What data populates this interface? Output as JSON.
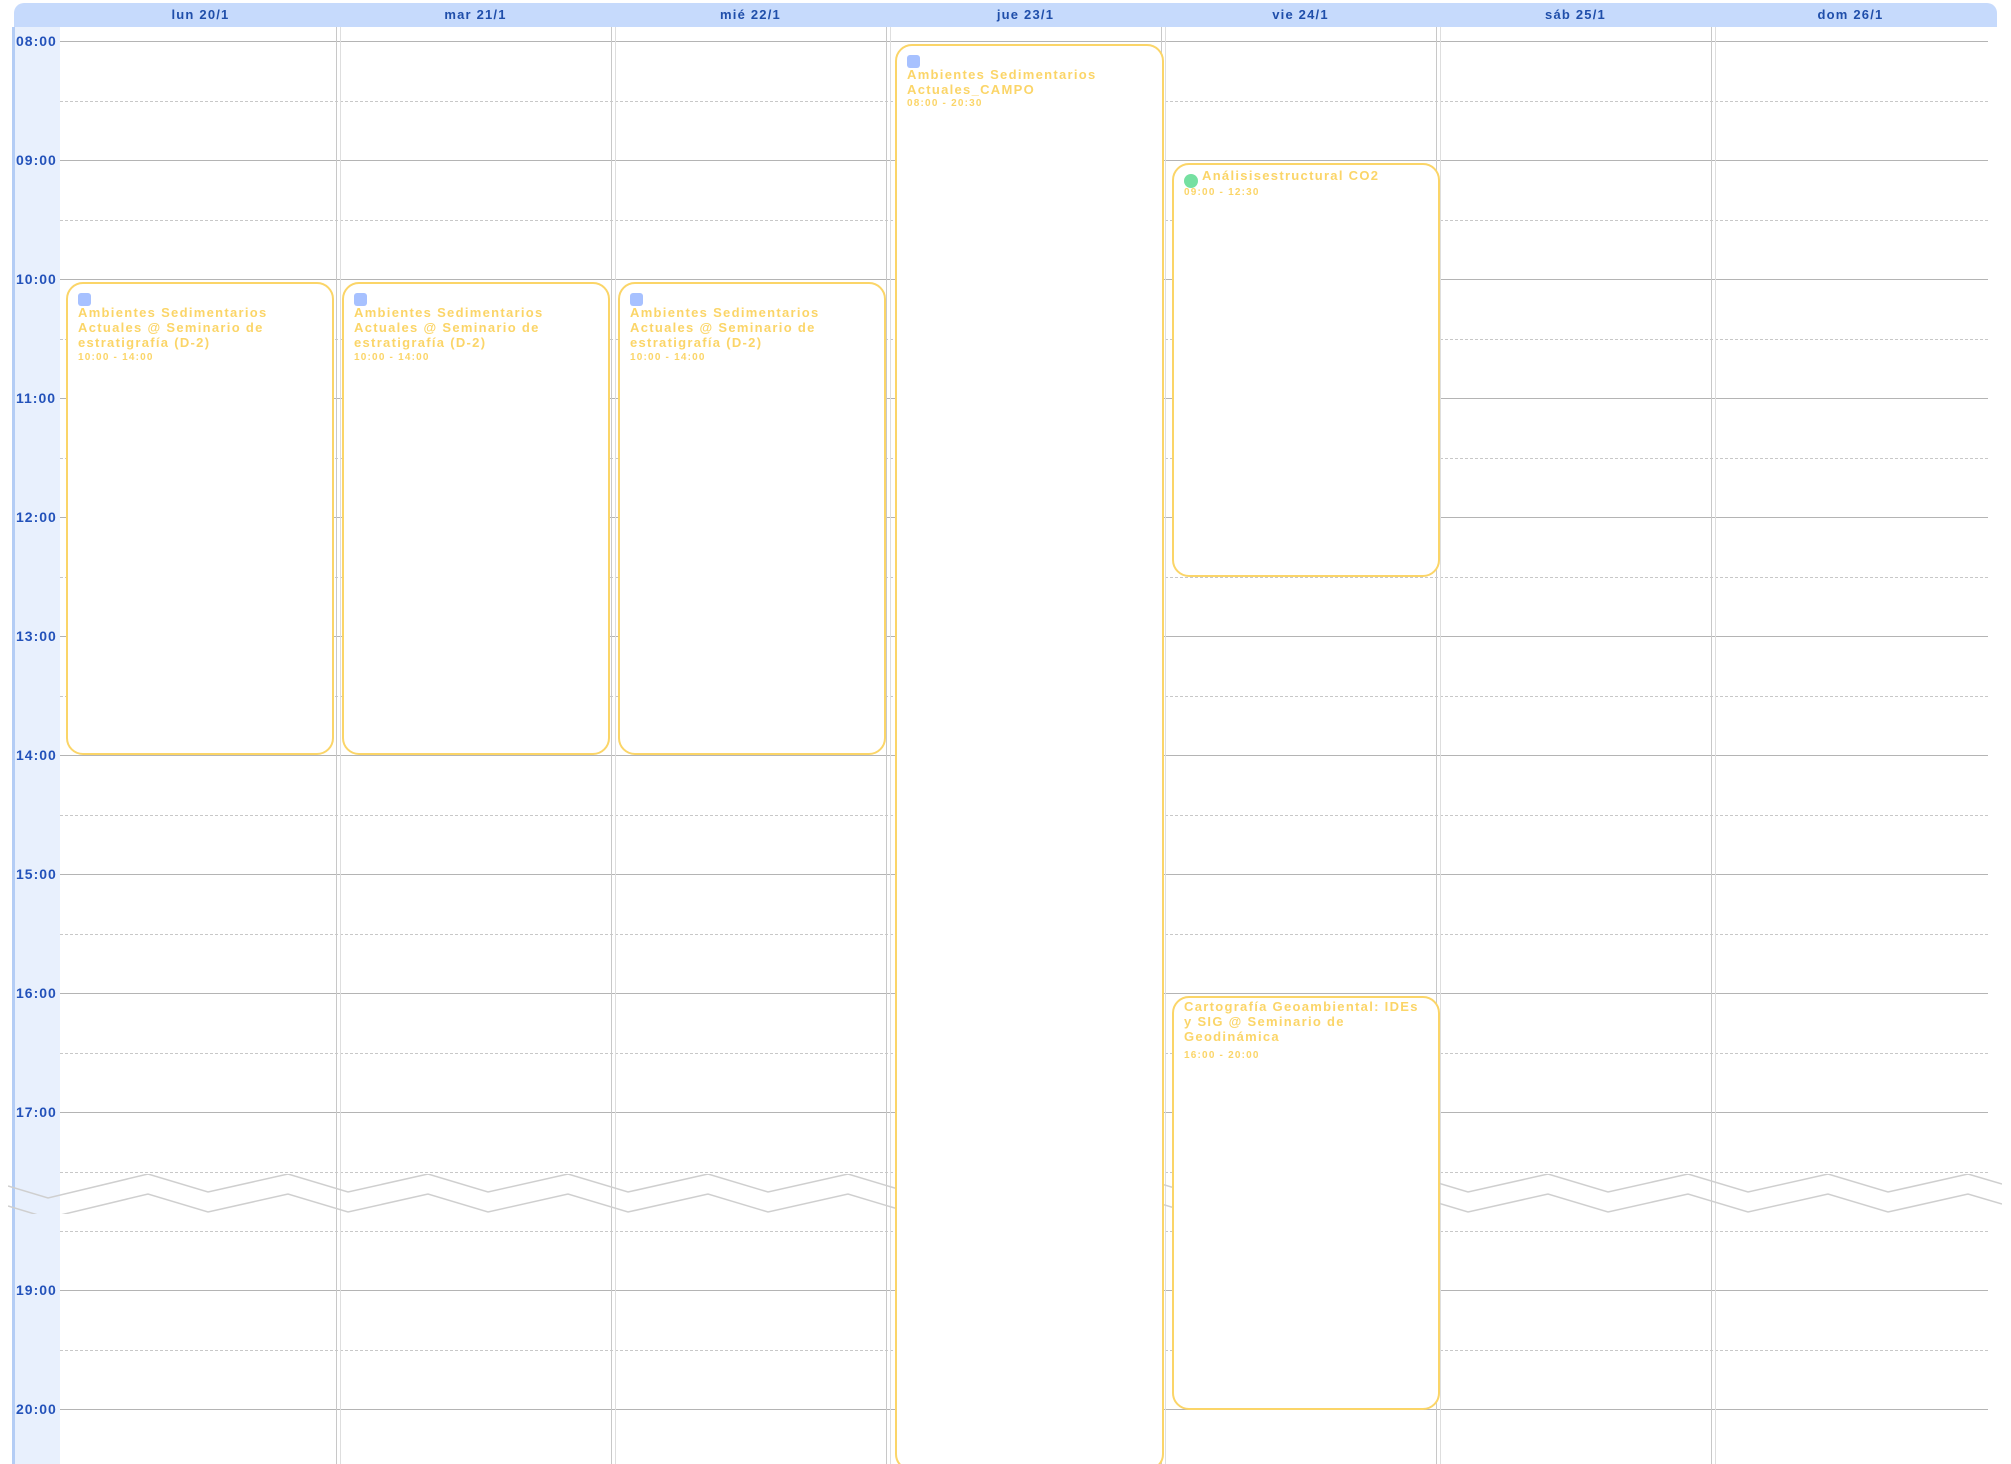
{
  "calendar": {
    "days": [
      "lun 20/1",
      "mar 21/1",
      "mié 22/1",
      "jue 23/1",
      "vie 24/1",
      "sáb 25/1",
      "dom 26/1"
    ],
    "times": [
      "08:00",
      "09:00",
      "10:00",
      "11:00",
      "12:00",
      "13:00",
      "14:00",
      "15:00",
      "16:00",
      "17:00",
      "19:00",
      "20:00"
    ],
    "events": [
      {
        "title": "Ambientes Sedimentarios Actuales @ Seminario de estratigrafía (D-2)",
        "time": "10:00 - 14:00",
        "day": "lun 20/1",
        "icon": "blue-square-icon"
      },
      {
        "title": "Ambientes Sedimentarios Actuales @ Seminario de estratigrafía (D-2)",
        "time": "10:00 - 14:00",
        "day": "mar 21/1",
        "icon": "blue-square-icon"
      },
      {
        "title": "Ambientes Sedimentarios Actuales @ Seminario de estratigrafía (D-2)",
        "time": "10:00 - 14:00",
        "day": "mié 22/1",
        "icon": "blue-square-icon"
      },
      {
        "title": "Ambientes Sedimentarios Actuales_CAMPO",
        "time": "08:00 - 20:30",
        "day": "jue 23/1",
        "icon": "blue-square-icon"
      },
      {
        "title": "Análisisestructural CO2",
        "time": "09:00 - 12:30",
        "day": "vie 24/1",
        "icon": "green-dot-icon"
      },
      {
        "title": "Cartografía Geoambiental: IDEs y SIG @ Seminario de Geodinámica",
        "time": "16:00 - 20:00",
        "day": "vie 24/1",
        "icon": ""
      }
    ]
  },
  "colors": {
    "header_background": "#c6dafc",
    "header_text": "#1f4eaa",
    "time_gutter": "#e8f0fd",
    "event_border": "#fbd568",
    "event_text": "#fbd568",
    "blue_event_icon": "#a7c1ff",
    "green_event_icon": "#75e0a1"
  }
}
